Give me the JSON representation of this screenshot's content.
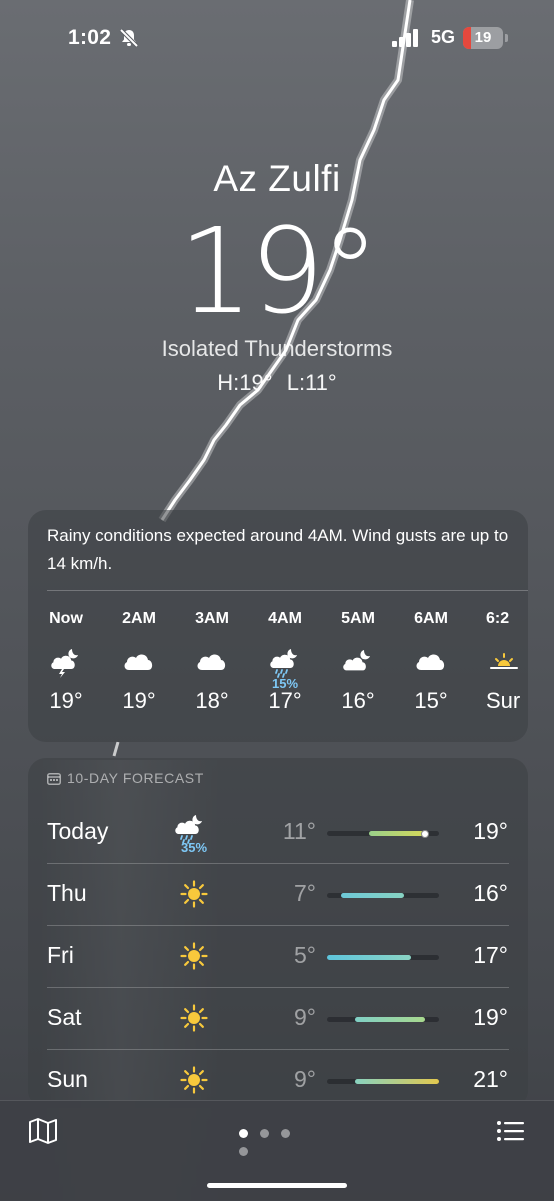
{
  "status_bar": {
    "time": "1:02",
    "network": "5G",
    "battery_level": "19",
    "battery_fraction": 0.19,
    "battery_color": "#e5483d",
    "icons": [
      "bell-slash-icon",
      "signal-icon"
    ]
  },
  "location": {
    "city": "Az Zulfi",
    "temperature": "19°",
    "condition": "Isolated Thunderstorms",
    "high": "H:19°",
    "low": "L:11°"
  },
  "hourly": {
    "summary": "Rainy conditions expected around 4AM. Wind gusts are up to 14 km/h.",
    "hours": [
      {
        "label": "Now",
        "icon": "moon-cloud-thunder-icon",
        "temp": "19°",
        "precip": ""
      },
      {
        "label": "2AM",
        "icon": "cloud-icon",
        "temp": "19°",
        "precip": ""
      },
      {
        "label": "3AM",
        "icon": "cloud-icon",
        "temp": "18°",
        "precip": ""
      },
      {
        "label": "4AM",
        "icon": "moon-cloud-rain-icon",
        "temp": "17°",
        "precip": "15%"
      },
      {
        "label": "5AM",
        "icon": "moon-cloud-icon",
        "temp": "16°",
        "precip": ""
      },
      {
        "label": "6AM",
        "icon": "cloud-icon",
        "temp": "15°",
        "precip": ""
      },
      {
        "label": "6:2",
        "icon": "sunrise-icon",
        "temp": "Sur",
        "precip": ""
      }
    ]
  },
  "daily": {
    "heading": "10-DAY FORECAST",
    "range_min": 5,
    "range_max": 21,
    "current_temp": 19,
    "days": [
      {
        "day": "Today",
        "icon": "moon-cloud-rain-icon",
        "precip": "35%",
        "low": "11°",
        "high": "19°",
        "low_val": 11,
        "high_val": 19,
        "bar_colors": [
          "#9ad18b",
          "#d4d85a"
        ]
      },
      {
        "day": "Thu",
        "icon": "sun-icon",
        "precip": "",
        "low": "7°",
        "high": "16°",
        "low_val": 7,
        "high_val": 16,
        "bar_colors": [
          "#6ec9d8",
          "#87d2c2"
        ]
      },
      {
        "day": "Fri",
        "icon": "sun-icon",
        "precip": "",
        "low": "5°",
        "high": "17°",
        "low_val": 5,
        "high_val": 17,
        "bar_colors": [
          "#5ec5dc",
          "#8ad4c4"
        ]
      },
      {
        "day": "Sat",
        "icon": "sun-icon",
        "precip": "",
        "low": "9°",
        "high": "19°",
        "low_val": 9,
        "high_val": 19,
        "bar_colors": [
          "#80d0c6",
          "#a8d88e"
        ]
      },
      {
        "day": "Sun",
        "icon": "sun-icon",
        "precip": "",
        "low": "9°",
        "high": "21°",
        "low_val": 9,
        "high_val": 21,
        "bar_colors": [
          "#88d2c0",
          "#e2c84e"
        ]
      }
    ]
  },
  "bottom_bar": {
    "left_icon": "map-icon",
    "right_icon": "list-icon",
    "page_count": 4,
    "active_page": 1
  }
}
